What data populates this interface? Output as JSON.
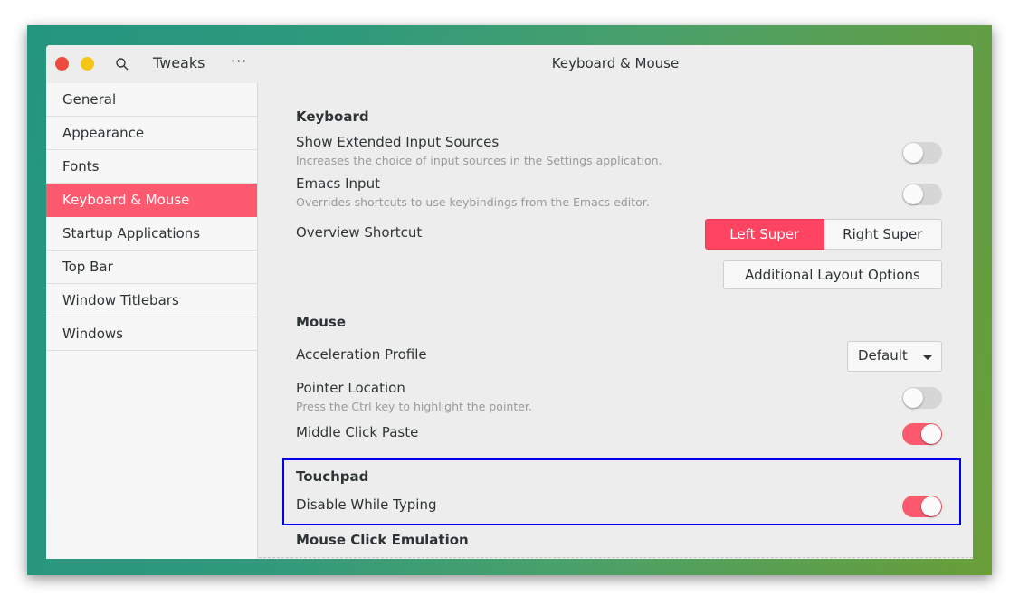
{
  "window": {
    "app_title": "Tweaks",
    "page_title": "Keyboard & Mouse",
    "more_label": "···"
  },
  "colors": {
    "accent": "#fe5a6f",
    "close": "#ee4b3e",
    "minimize": "#f5c518",
    "highlight_box": "#0000ee"
  },
  "sidebar": {
    "items": [
      {
        "label": "General",
        "active": false
      },
      {
        "label": "Appearance",
        "active": false
      },
      {
        "label": "Fonts",
        "active": false
      },
      {
        "label": "Keyboard & Mouse",
        "active": true
      },
      {
        "label": "Startup Applications",
        "active": false
      },
      {
        "label": "Top Bar",
        "active": false
      },
      {
        "label": "Window Titlebars",
        "active": false
      },
      {
        "label": "Windows",
        "active": false
      }
    ]
  },
  "keyboard": {
    "title": "Keyboard",
    "extended_input": {
      "label": "Show Extended Input Sources",
      "desc": "Increases the choice of input sources in the Settings application.",
      "on": false
    },
    "emacs_input": {
      "label": "Emacs Input",
      "desc": "Overrides shortcuts to use keybindings from the Emacs editor.",
      "on": false
    },
    "overview_shortcut": {
      "label": "Overview Shortcut",
      "options": [
        "Left Super",
        "Right Super"
      ],
      "selected": "Left Super"
    },
    "additional_layout_button": "Additional Layout Options"
  },
  "mouse": {
    "title": "Mouse",
    "acceleration": {
      "label": "Acceleration Profile",
      "value": "Default"
    },
    "pointer_location": {
      "label": "Pointer Location",
      "desc": "Press the Ctrl key to highlight the pointer.",
      "on": false
    },
    "middle_click": {
      "label": "Middle Click Paste",
      "on": true
    }
  },
  "touchpad": {
    "title": "Touchpad",
    "disable_while_typing": {
      "label": "Disable While Typing",
      "on": true
    }
  },
  "mouse_click_emulation": {
    "title": "Mouse Click Emulation"
  }
}
